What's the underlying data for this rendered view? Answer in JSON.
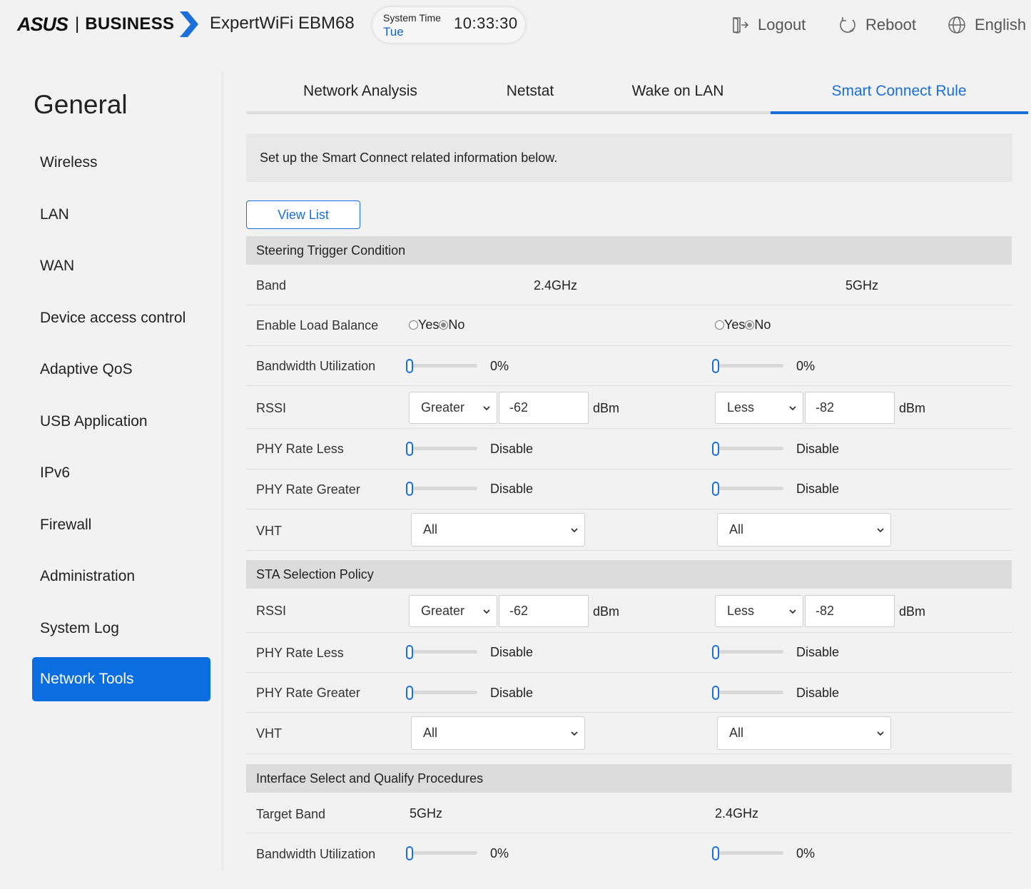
{
  "header": {
    "brand": "ASUS",
    "brand_sep": "|",
    "brand_business": "BUSINESS",
    "model": "ExpertWiFi EBM68",
    "system_time_label": "System Time",
    "system_day": "Tue",
    "system_clock": "10:33:30",
    "logout": "Logout",
    "reboot": "Reboot",
    "language": "English",
    "accent_color": "#1a6fd8"
  },
  "sidebar": {
    "title": "General",
    "items": [
      {
        "label": "Wireless"
      },
      {
        "label": "LAN"
      },
      {
        "label": "WAN"
      },
      {
        "label": "Device access control"
      },
      {
        "label": "Adaptive QoS"
      },
      {
        "label": "USB Application"
      },
      {
        "label": "IPv6"
      },
      {
        "label": "Firewall"
      },
      {
        "label": "Administration"
      },
      {
        "label": "System Log"
      },
      {
        "label": "Network Tools",
        "active": true
      }
    ]
  },
  "tabs": [
    {
      "label": "Network Analysis"
    },
    {
      "label": "Netstat"
    },
    {
      "label": "Wake on LAN"
    },
    {
      "label": "Smart Connect Rule",
      "active": true
    }
  ],
  "info_text": "Set up the Smart Connect related information below.",
  "view_list_label": "View List",
  "steering": {
    "title": "Steering Trigger Condition",
    "band_label": "Band",
    "band_a": "2.4GHz",
    "band_b": "5GHz",
    "load_balance_label": "Enable Load Balance",
    "yes": "Yes",
    "no": "No",
    "bw_label": "Bandwidth Utilization",
    "bw_a": "0%",
    "bw_b": "0%",
    "rssi_label": "RSSI",
    "rssi_a_cmp": "Greater",
    "rssi_a_val": "-62",
    "rssi_b_cmp": "Less",
    "rssi_b_val": "-82",
    "dbm": "dBm",
    "phy_less_label": "PHY Rate Less",
    "phy_greater_label": "PHY Rate Greater",
    "disable": "Disable",
    "vht_label": "VHT",
    "vht_a": "All",
    "vht_b": "All"
  },
  "sta": {
    "title": "STA Selection Policy",
    "rssi_label": "RSSI",
    "rssi_a_cmp": "Greater",
    "rssi_a_val": "-62",
    "rssi_b_cmp": "Less",
    "rssi_b_val": "-82",
    "dbm": "dBm",
    "phy_less_label": "PHY Rate Less",
    "phy_greater_label": "PHY Rate Greater",
    "disable": "Disable",
    "vht_label": "VHT",
    "vht_a": "All",
    "vht_b": "All"
  },
  "iface": {
    "title": "Interface Select and Qualify Procedures",
    "target_label": "Target Band",
    "target_a": "5GHz",
    "target_b": "2.4GHz",
    "bw_label": "Bandwidth Utilization",
    "bw_a": "0%",
    "bw_b": "0%"
  },
  "slider_value": 0
}
